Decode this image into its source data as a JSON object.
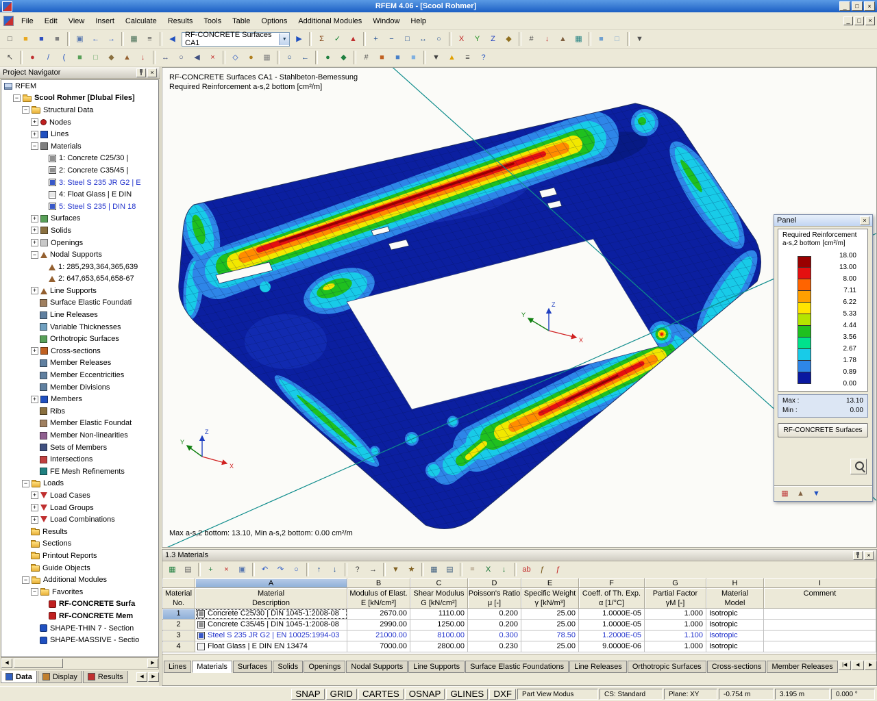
{
  "window": {
    "title": "RFEM 4.06 - [Scool Rohmer]"
  },
  "ui": {
    "minimize_glyph": "_",
    "maximize_glyph": "□",
    "close_glyph": "×",
    "dropdown_glyph": "▼",
    "left_glyph": "◀",
    "right_glyph": "▶"
  },
  "menu": {
    "items": [
      "File",
      "Edit",
      "View",
      "Insert",
      "Calculate",
      "Results",
      "Tools",
      "Table",
      "Options",
      "Additional Modules",
      "Window",
      "Help"
    ]
  },
  "toolbar1": {
    "combo_label": "RF-CONCRETE Surfaces CA1",
    "buttons_before": [
      {
        "name": "new-file",
        "glyph": "□",
        "color": "#404040"
      },
      {
        "name": "open-project",
        "glyph": "■",
        "color": "#E8A820"
      },
      {
        "name": "save-project",
        "glyph": "■",
        "color": "#3050C0"
      },
      {
        "name": "print",
        "glyph": "■",
        "color": "#808080"
      },
      "|",
      {
        "name": "copy",
        "glyph": "▣",
        "color": "#5878B0"
      },
      {
        "name": "undo",
        "glyph": "←",
        "color": "#2858C8"
      },
      {
        "name": "redo",
        "glyph": "→",
        "color": "#2858C8"
      },
      "|",
      {
        "name": "data-tables",
        "glyph": "▦",
        "color": "#487058"
      },
      {
        "name": "navigator-toggle",
        "glyph": "≡",
        "color": "#505050"
      },
      "|",
      {
        "name": "previous-load-case",
        "glyph": "◀",
        "color": "#2050C0"
      }
    ],
    "buttons_after": [
      {
        "name": "next-load-case",
        "glyph": "▶",
        "color": "#2050C0"
      },
      "|",
      {
        "name": "calculation",
        "glyph": "Σ",
        "color": "#804010"
      },
      {
        "name": "check-results",
        "glyph": "✓",
        "color": "#108030"
      },
      {
        "name": "show-results",
        "glyph": "▲",
        "color": "#C03030"
      },
      "|",
      {
        "name": "zoom-in",
        "glyph": "+",
        "color": "#184890"
      },
      {
        "name": "zoom-out",
        "glyph": "−",
        "color": "#184890"
      },
      {
        "name": "zoom-window",
        "glyph": "□",
        "color": "#184890"
      },
      {
        "name": "move-view",
        "glyph": "↔",
        "color": "#184890"
      },
      {
        "name": "rotate-view",
        "glyph": "○",
        "color": "#184890"
      },
      "|",
      {
        "name": "view-x",
        "glyph": "X",
        "color": "#C02020"
      },
      {
        "name": "view-y",
        "glyph": "Y",
        "color": "#209020"
      },
      {
        "name": "view-z",
        "glyph": "Z",
        "color": "#2040C0"
      },
      {
        "name": "isometric-view",
        "glyph": "◆",
        "color": "#907020"
      },
      "|",
      {
        "name": "show-numbering",
        "glyph": "#",
        "color": "#505050"
      },
      {
        "name": "show-loads",
        "glyph": "↓",
        "color": "#C03030"
      },
      {
        "name": "show-supports",
        "glyph": "▲",
        "color": "#806040"
      },
      {
        "name": "show-fe-mesh",
        "glyph": "▦",
        "color": "#208080"
      },
      "|",
      {
        "name": "render-solid",
        "glyph": "■",
        "color": "#70A0D0"
      },
      {
        "name": "render-wireframe",
        "glyph": "□",
        "color": "#70A0D0"
      },
      "|",
      {
        "name": "display-properties",
        "glyph": "▼",
        "color": "#505050"
      }
    ]
  },
  "toolbar2": {
    "buttons": [
      {
        "name": "select-objects",
        "glyph": "↖",
        "color": "#404040"
      },
      "|",
      {
        "name": "new-node",
        "glyph": "●",
        "color": "#C03030"
      },
      {
        "name": "new-line",
        "glyph": "/",
        "color": "#2050C0"
      },
      {
        "name": "new-arc",
        "glyph": "(",
        "color": "#2050C0"
      },
      {
        "name": "new-surface",
        "glyph": "■",
        "color": "#58A058"
      },
      {
        "name": "new-opening",
        "glyph": "□",
        "color": "#58A058"
      },
      {
        "name": "new-solid",
        "glyph": "◆",
        "color": "#8A7040"
      },
      {
        "name": "new-support",
        "glyph": "▲",
        "color": "#946030"
      },
      {
        "name": "new-load",
        "glyph": "↓",
        "color": "#C03030"
      },
      "|",
      {
        "name": "edit-move",
        "glyph": "↔",
        "color": "#405080"
      },
      {
        "name": "edit-rotate",
        "glyph": "○",
        "color": "#405080"
      },
      {
        "name": "edit-mirror",
        "glyph": "◀",
        "color": "#405080"
      },
      {
        "name": "edit-delete",
        "glyph": "×",
        "color": "#C02020"
      },
      "|",
      {
        "name": "work-plane",
        "glyph": "◇",
        "color": "#2050C0"
      },
      {
        "name": "snap-toggle",
        "glyph": "●",
        "color": "#B08020"
      },
      {
        "name": "grid-toggle",
        "glyph": "▦",
        "color": "#808080"
      },
      "|",
      {
        "name": "zoom-all",
        "glyph": "○",
        "color": "#184890"
      },
      {
        "name": "zoom-previous",
        "glyph": "←",
        "color": "#184890"
      },
      "|",
      {
        "name": "visibility-all",
        "glyph": "●",
        "color": "#208040"
      },
      {
        "name": "visibility-partial",
        "glyph": "◆",
        "color": "#208040"
      },
      "|",
      {
        "name": "numbering-toggle",
        "glyph": "#",
        "color": "#505050"
      },
      {
        "name": "display-colors",
        "glyph": "■",
        "color": "#C06020"
      },
      {
        "name": "render-mode",
        "glyph": "■",
        "color": "#4880C8"
      },
      {
        "name": "background-color",
        "glyph": "■",
        "color": "#80B0E0"
      },
      "|",
      {
        "name": "user-views",
        "glyph": "▼",
        "color": "#404040"
      },
      {
        "name": "messages",
        "glyph": "▲",
        "color": "#E0A000"
      },
      {
        "name": "settings",
        "glyph": "≡",
        "color": "#404040"
      },
      {
        "name": "help",
        "glyph": "?",
        "color": "#2050C0"
      }
    ]
  },
  "navigator": {
    "title": "Project Navigator",
    "tabs": [
      {
        "label": "Data",
        "icon_color": "#3060C0",
        "active": true
      },
      {
        "label": "Display",
        "icon_color": "#C08030",
        "active": false
      },
      {
        "label": "Results",
        "icon_color": "#C03030",
        "active": false
      }
    ],
    "tree": [
      {
        "label": "RFEM",
        "level": 0,
        "box": "",
        "icon": "pc"
      },
      {
        "label": "Scool Rohmer [Dlubal Files]",
        "level": 1,
        "box": "-",
        "icon": "folder",
        "bold": true
      },
      {
        "label": "Structural Data",
        "level": 2,
        "box": "-",
        "icon": "folder"
      },
      {
        "label": "Nodes",
        "level": 3,
        "box": "+",
        "icon": "dot:#C02020"
      },
      {
        "label": "Lines",
        "level": 3,
        "box": "+",
        "icon": "sq:#2050C0"
      },
      {
        "label": "Materials",
        "level": 3,
        "box": "-",
        "icon": "sq:#808080"
      },
      {
        "label": "1: Concrete C25/30 |",
        "level": 4,
        "box": "",
        "icon": "mat:#909090"
      },
      {
        "label": "2: Concrete C35/45 |",
        "level": 4,
        "box": "",
        "icon": "mat:#909090"
      },
      {
        "label": "3: Steel S 235 JR G2 | E",
        "level": 4,
        "box": "",
        "icon": "mat:#3858C8",
        "color": "#2233CC"
      },
      {
        "label": "4: Float Glass | E DIN",
        "level": 4,
        "box": "",
        "icon": "mat:#E8E8E8"
      },
      {
        "label": "5: Steel S 235 | DIN 18",
        "level": 4,
        "box": "",
        "icon": "mat:#3858C8",
        "color": "#2233CC"
      },
      {
        "label": "Surfaces",
        "level": 3,
        "box": "+",
        "icon": "sq:#58A058"
      },
      {
        "label": "Solids",
        "level": 3,
        "box": "+",
        "icon": "sq:#8A7040"
      },
      {
        "label": "Openings",
        "level": 3,
        "box": "+",
        "icon": "sq:#C8C8C8"
      },
      {
        "label": "Nodal Supports",
        "level": 3,
        "box": "-",
        "icon": "tri:#946030"
      },
      {
        "label": "1: 285,293,364,365,639",
        "level": 4,
        "box": "",
        "icon": "tri:#946030"
      },
      {
        "label": "2: 647,653,654,658-67",
        "level": 4,
        "box": "",
        "icon": "tri:#946030"
      },
      {
        "label": "Line Supports",
        "level": 3,
        "box": "+",
        "icon": "tri:#946030"
      },
      {
        "label": "Surface Elastic Foundati",
        "level": 3,
        "box": "",
        "icon": "sq:#A08060"
      },
      {
        "label": "Line Releases",
        "level": 3,
        "box": "",
        "icon": "sq:#6080A0"
      },
      {
        "label": "Variable Thicknesses",
        "level": 3,
        "box": "",
        "icon": "sq:#70A0C0"
      },
      {
        "label": "Orthotropic Surfaces",
        "level": 3,
        "box": "",
        "icon": "sq:#58A058"
      },
      {
        "label": "Cross-sections",
        "level": 3,
        "box": "+",
        "icon": "sq:#C06020"
      },
      {
        "label": "Member Releases",
        "level": 3,
        "box": "",
        "icon": "sq:#6080A0"
      },
      {
        "label": "Member Eccentricities",
        "level": 3,
        "box": "",
        "icon": "sq:#6080A0"
      },
      {
        "label": "Member Divisions",
        "level": 3,
        "box": "",
        "icon": "sq:#6080A0"
      },
      {
        "label": "Members",
        "level": 3,
        "box": "+",
        "icon": "sq:#2050C0"
      },
      {
        "label": "Ribs",
        "level": 3,
        "box": "",
        "icon": "sq:#8A7040"
      },
      {
        "label": "Member Elastic Foundat",
        "level": 3,
        "box": "",
        "icon": "sq:#A08060"
      },
      {
        "label": "Member Non-linearities",
        "level": 3,
        "box": "",
        "icon": "sq:#906090"
      },
      {
        "label": "Sets of Members",
        "level": 3,
        "box": "",
        "icon": "sq:#405080"
      },
      {
        "label": "Intersections",
        "level": 3,
        "box": "",
        "icon": "sq:#C04040"
      },
      {
        "label": "FE Mesh Refinements",
        "level": 3,
        "box": "",
        "icon": "sq:#208080"
      },
      {
        "label": "Loads",
        "level": 2,
        "box": "-",
        "icon": "folder"
      },
      {
        "label": "Load Cases",
        "level": 3,
        "box": "+",
        "icon": "arr:#C03030"
      },
      {
        "label": "Load Groups",
        "level": 3,
        "box": "+",
        "icon": "arr:#C03030"
      },
      {
        "label": "Load Combinations",
        "level": 3,
        "box": "+",
        "icon": "arr:#C03030"
      },
      {
        "label": "Results",
        "level": 2,
        "box": "",
        "icon": "folder"
      },
      {
        "label": "Sections",
        "level": 2,
        "box": "",
        "icon": "folder"
      },
      {
        "label": "Printout Reports",
        "level": 2,
        "box": "",
        "icon": "folder"
      },
      {
        "label": "Guide Objects",
        "level": 2,
        "box": "",
        "icon": "folder"
      },
      {
        "label": "Additional Modules",
        "level": 2,
        "box": "-",
        "icon": "folder"
      },
      {
        "label": "Favorites",
        "level": 3,
        "box": "-",
        "icon": "folder"
      },
      {
        "label": "RF-CONCRETE Surfa",
        "level": 4,
        "box": "",
        "icon": "mod:#C02020",
        "bold": true
      },
      {
        "label": "RF-CONCRETE Mem",
        "level": 4,
        "box": "",
        "icon": "mod:#C02020",
        "bold": true
      },
      {
        "label": "SHAPE-THIN 7 - Section",
        "level": 3,
        "box": "",
        "icon": "mod:#2050C0"
      },
      {
        "label": "SHAPE-MASSIVE - Sectio",
        "level": 3,
        "box": "",
        "icon": "mod:#2050C0"
      }
    ]
  },
  "viewport": {
    "header_line1": "RF-CONCRETE Surfaces CA1 - Stahlbeton-Bemessung",
    "header_line2": "Required Reinforcement a-s,2 bottom [cm²/m]",
    "footer": "Max a-s,2 bottom: 13.10, Min a-s,2 bottom: 0.00 cm²/m",
    "axes": {
      "x": "X",
      "y": "Y",
      "z": "Z"
    }
  },
  "panel": {
    "title": "Panel",
    "legend": {
      "title_line1": "Required Reinforcement",
      "title_line2": "a-s,2 bottom [cm²/m]",
      "values": [
        "18.00",
        "13.00",
        "8.00",
        "7.11",
        "6.22",
        "5.33",
        "4.44",
        "3.56",
        "2.67",
        "1.78",
        "0.89",
        "0.00"
      ],
      "colors": [
        "#9A0000",
        "#E41010",
        "#FF6400",
        "#FFA000",
        "#FFE400",
        "#B4E400",
        "#1FC01F",
        "#00E28C",
        "#18CBE8",
        "#2E86E8",
        "#0A18A0"
      ],
      "max_label": "Max :",
      "max_value": "13.10",
      "min_label": "Min :",
      "min_value": "0.00"
    },
    "module_button": "RF-CONCRETE Surfaces",
    "strip_icons": [
      {
        "name": "panel-colors",
        "glyph": "▦",
        "color": "#C04040"
      },
      {
        "name": "panel-scale",
        "glyph": "▲",
        "color": "#806040"
      },
      {
        "name": "panel-options",
        "glyph": "▼",
        "color": "#2050C0"
      }
    ]
  },
  "table_panel": {
    "title": "1.3 Materials",
    "toolbar": [
      {
        "name": "table-select",
        "glyph": "▦",
        "color": "#208040"
      },
      {
        "name": "table-view",
        "glyph": "▤",
        "color": "#606060"
      },
      "|",
      {
        "name": "insert-row",
        "glyph": "+",
        "color": "#208040"
      },
      {
        "name": "delete-row",
        "glyph": "×",
        "color": "#C02020"
      },
      {
        "name": "copy-row",
        "glyph": "▣",
        "color": "#5878B0"
      },
      "|",
      {
        "name": "table-undo",
        "glyph": "↶",
        "color": "#2858C8"
      },
      {
        "name": "table-redo",
        "glyph": "↷",
        "color": "#2858C8"
      },
      {
        "name": "table-refresh",
        "glyph": "○",
        "color": "#2858C8"
      },
      "|",
      {
        "name": "move-up",
        "glyph": "↑",
        "color": "#184890"
      },
      {
        "name": "move-down",
        "glyph": "↓",
        "color": "#184890"
      },
      "|",
      {
        "name": "find",
        "glyph": "?",
        "color": "#404040"
      },
      {
        "name": "goto",
        "glyph": "→",
        "color": "#404040"
      },
      "|",
      {
        "name": "filter",
        "glyph": "▼",
        "color": "#806020"
      },
      {
        "name": "select-special",
        "glyph": "★",
        "color": "#806020"
      },
      "|",
      {
        "name": "table-grid",
        "glyph": "▦",
        "color": "#406080"
      },
      {
        "name": "table-freeze",
        "glyph": "▤",
        "color": "#406080"
      },
      "|",
      {
        "name": "calculator",
        "glyph": "=",
        "color": "#705030"
      },
      {
        "name": "excel-export",
        "glyph": "X",
        "color": "#107030"
      },
      {
        "name": "import-data",
        "glyph": "↓",
        "color": "#107030"
      },
      "|",
      {
        "name": "spell-check",
        "glyph": "ab",
        "color": "#C02020"
      },
      {
        "name": "formula-fx",
        "glyph": "ƒ",
        "color": "#705010"
      },
      {
        "name": "formula-delete",
        "glyph": "ƒ",
        "color": "#C02020"
      }
    ],
    "letters": [
      "A",
      "B",
      "C",
      "D",
      "E",
      "F",
      "G",
      "H",
      "I"
    ],
    "selected_letter": "A",
    "left_header": {
      "l1": "Material",
      "l2": "No."
    },
    "header_groups": [
      {
        "l1": "Material",
        "l2": "Description"
      },
      {
        "l1": "Modulus of Elast.",
        "l2": "E [kN/cm²]"
      },
      {
        "l1": "Shear Modulus",
        "l2": "G [kN/cm²]"
      },
      {
        "l1": "Poisson's Ratio",
        "l2": "μ [-]"
      },
      {
        "l1": "Specific Weight",
        "l2": "γ [kN/m³]"
      },
      {
        "l1": "Coeff. of Th. Exp.",
        "l2": "α [1/°C]"
      },
      {
        "l1": "Partial Factor",
        "l2": "γM [-]"
      },
      {
        "l1": "Material",
        "l2": "Model"
      },
      {
        "l1": "Comment",
        "l2": ""
      }
    ],
    "rows": [
      {
        "no": "1",
        "selected": true,
        "chip": "#909090",
        "desc": "Concrete C25/30 | DIN 1045-1:2008-08",
        "values": [
          "2670.00",
          "1110.00",
          "0.200",
          "25.00",
          "1.0000E-05",
          "1.000"
        ],
        "model": "Isotropic",
        "comment": ""
      },
      {
        "no": "2",
        "chip": "#909090",
        "desc": "Concrete C35/45 | DIN 1045-1:2008-08",
        "values": [
          "2990.00",
          "1250.00",
          "0.200",
          "25.00",
          "1.0000E-05",
          "1.000"
        ],
        "model": "Isotropic",
        "comment": ""
      },
      {
        "no": "3",
        "chip": "#3858C8",
        "desc": "Steel S 235 JR G2 | EN 10025:1994-03",
        "color": "#2233CC",
        "values": [
          "21000.00",
          "8100.00",
          "0.300",
          "78.50",
          "1.2000E-05",
          "1.100"
        ],
        "model": "Isotropic",
        "comment": ""
      },
      {
        "no": "4",
        "chip": "#F0F0F0",
        "desc": "Float Glass | E DIN EN 13474",
        "values": [
          "7000.00",
          "2800.00",
          "0.230",
          "25.00",
          "9.0000E-06",
          "1.000"
        ],
        "model": "Isotropic",
        "comment": ""
      }
    ],
    "tabs": [
      "Lines",
      "Materials",
      "Surfaces",
      "Solids",
      "Openings",
      "Nodal Supports",
      "Line Supports",
      "Surface Elastic Foundations",
      "Line Releases",
      "Orthotropic Surfaces",
      "Cross-sections",
      "Member Releases"
    ],
    "active_tab": "Materials",
    "tab_arrows": [
      "|◀",
      "◀",
      "▶",
      "▶|"
    ]
  },
  "statusbar": {
    "toggles": [
      "SNAP",
      "GRID",
      "CARTES",
      "OSNAP",
      "GLINES",
      "DXF"
    ],
    "mode": "Part View Modus",
    "cs": "CS: Standard",
    "plane": "Plane: XY",
    "coord_x": "-0.754 m",
    "coord_y": "3.195 m",
    "angle": "0.000 °"
  }
}
